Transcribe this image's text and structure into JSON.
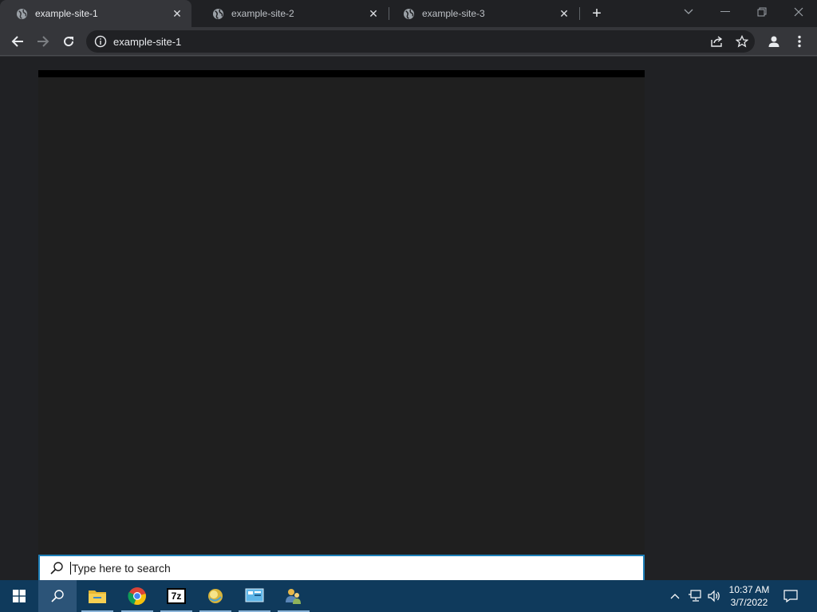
{
  "browser": {
    "tabs": [
      {
        "title": "example-site-1",
        "active": true
      },
      {
        "title": "example-site-2",
        "active": false
      },
      {
        "title": "example-site-3",
        "active": false
      }
    ],
    "new_tab_label": "+",
    "address_bar": {
      "url": "example-site-1"
    },
    "icons": [
      "globe-icon",
      "close-icon",
      "back-icon",
      "forward-icon",
      "reload-icon",
      "info-icon",
      "share-icon",
      "star-icon",
      "profile-icon",
      "menu-icon",
      "minimize-icon",
      "restore-icon",
      "window-close-icon",
      "tab-search-icon"
    ]
  },
  "search_popup": {
    "placeholder": "Type here to search"
  },
  "taskbar": {
    "apps": [
      "start-icon",
      "search-icon",
      "file-explorer-icon",
      "chrome-icon",
      "seven-zip-icon",
      "app-orb-icon",
      "control-panel-icon",
      "users-icon"
    ],
    "seven_zip_label": "7z",
    "clock": {
      "time": "10:37 AM",
      "date": "3/7/2022"
    }
  },
  "colors": {
    "tabstrip": "#202124",
    "toolbar": "#35363a",
    "page_bg": "#202124",
    "taskbar": "#0f3a5c",
    "search_border": "#1d7fb8"
  }
}
